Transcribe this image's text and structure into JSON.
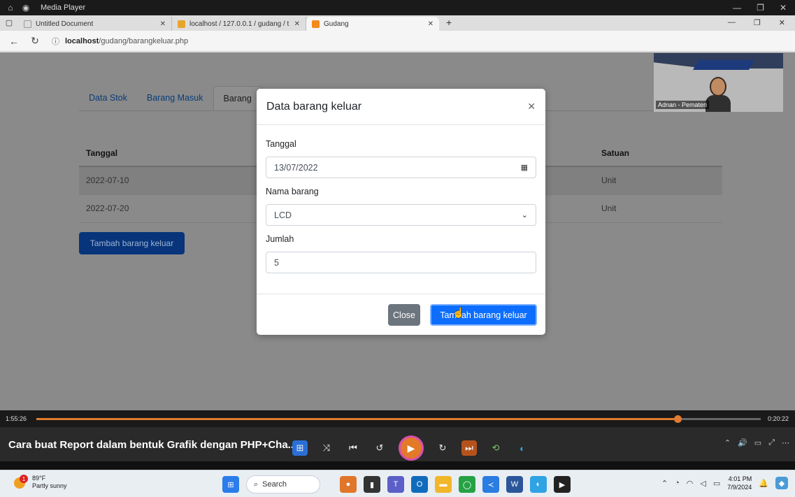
{
  "media_player": {
    "title": "Media Player",
    "elapsed": "1:55:26",
    "remaining": "0:20:22",
    "progress": 0.885,
    "video_title": "Cara buat Report dalam bentuk Grafik dengan PHP+Cha...",
    "accent_color": "#e07b2f"
  },
  "browser": {
    "tabs": [
      {
        "label": "Untitled Document"
      },
      {
        "label": "localhost / 127.0.0.1 / gudang / t"
      },
      {
        "label": "Gudang"
      }
    ],
    "url_host": "localhost",
    "url_path": "/gudang/barangkeluar.php"
  },
  "page": {
    "nav_tabs": [
      "Data Stok",
      "Barang Masuk",
      "Barang"
    ],
    "table": {
      "headers": [
        "Tanggal",
        "Satuan"
      ],
      "rows": [
        {
          "tanggal": "2022-07-10",
          "satuan": "Unit"
        },
        {
          "tanggal": "2022-07-20",
          "satuan": "Unit"
        }
      ]
    },
    "add_button": "Tambah barang keluar"
  },
  "modal": {
    "title": "Data barang keluar",
    "fields": {
      "tanggal_label": "Tanggal",
      "tanggal_value": "13/07/2022",
      "nama_label": "Nama barang",
      "nama_value": "LCD",
      "jumlah_label": "Jumlah",
      "jumlah_value": "5"
    },
    "close_label": "Close",
    "submit_label": "Tambah barang keluar",
    "primary_color": "#0d6efd"
  },
  "webcam": {
    "name": "Adnan - Pemateri"
  },
  "taskbar": {
    "weather_temp": "89°F",
    "weather_desc": "Partly sunny",
    "weather_badge": "1",
    "search_placeholder": "Search",
    "time": "4:01 PM",
    "date": "7/9/2024"
  }
}
